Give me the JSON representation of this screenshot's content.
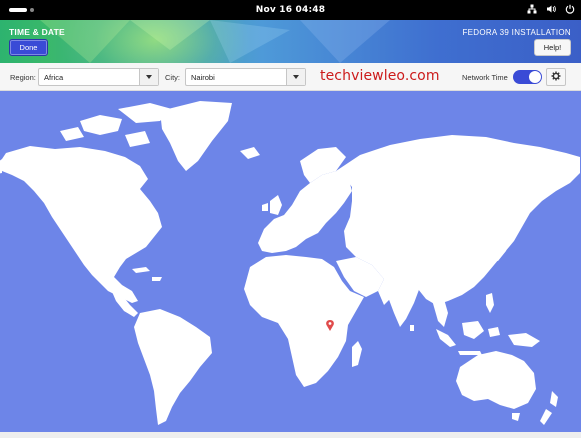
{
  "topbar": {
    "clock": "Nov 16  04:48",
    "icons": [
      "activities-indicator",
      "network-wired-icon",
      "volume-icon",
      "power-icon"
    ]
  },
  "header": {
    "spoke_title": "TIME & DATE",
    "done_label": "Done",
    "product_title": "FEDORA 39 INSTALLATION",
    "help_label": "Help!"
  },
  "toolbar": {
    "region_label": "Region:",
    "region_value": "Africa",
    "city_label": "City:",
    "city_value": "Nairobi",
    "watermark": "techviewleo.com",
    "network_time_label": "Network Time",
    "network_time_enabled": true,
    "config_icon": "gear-icon"
  },
  "colors": {
    "ocean": "#6d85e8",
    "land": "#ffffff",
    "accent": "#3a4bd6",
    "marker": "#e04b4b",
    "watermark": "#cc1b1b"
  },
  "map": {
    "selected_city_marker": "map-pin-icon"
  }
}
